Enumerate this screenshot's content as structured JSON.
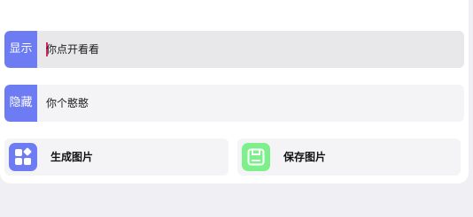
{
  "show_row": {
    "tag": "显示",
    "value": "你点开看看"
  },
  "hide_row": {
    "tag": "隐藏",
    "value": "你个憨憨"
  },
  "actions": [
    {
      "label": "生成图片",
      "icon": "apps-grid-icon",
      "color": "#6e7cf3"
    },
    {
      "label": "保存图片",
      "icon": "save-floppy-icon",
      "color": "#7df08c"
    }
  ],
  "colors": {
    "accent": "#6e7cf3",
    "save_accent": "#7df08c",
    "caret": "#e0245e"
  }
}
